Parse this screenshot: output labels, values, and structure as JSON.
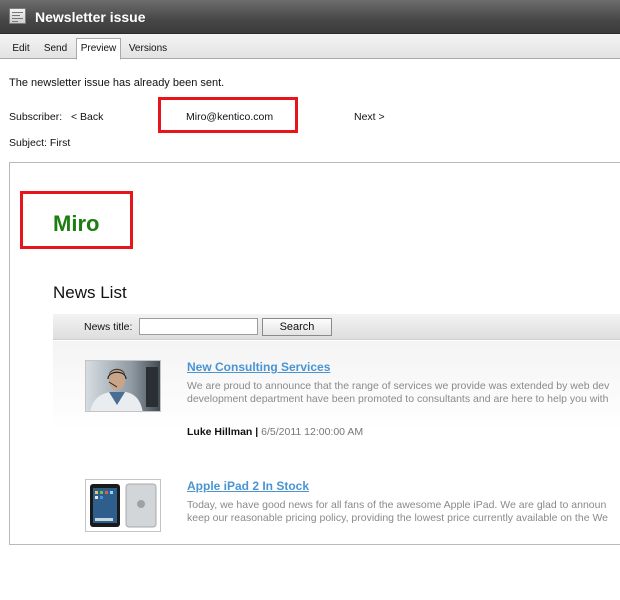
{
  "window": {
    "title": "Newsletter issue",
    "icon": "newsletter-icon"
  },
  "tabs": [
    {
      "label": "Edit",
      "active": false
    },
    {
      "label": "Send",
      "active": false
    },
    {
      "label": "Preview",
      "active": true
    },
    {
      "label": "Versions",
      "active": false
    }
  ],
  "status_message": "The newsletter issue has already been sent.",
  "subscriber": {
    "label": "Subscriber:",
    "back": "< Back",
    "email": "Miro@kentico.com",
    "next": "Next >"
  },
  "subject": {
    "text": "Subject: First"
  },
  "preview": {
    "greeting": "Miro",
    "news_list_title": "News List",
    "search": {
      "label": "News title:",
      "value": "",
      "button": "Search"
    },
    "articles": [
      {
        "title": "New Consulting Services",
        "text_line1": "We are proud to announce that the range of services we provide was extended by web dev",
        "text_line2": "development department have been promoted to consultants and are here to help you with",
        "author": "Luke Hillman",
        "separator": " | ",
        "date": "6/5/2011 12:00:00 AM",
        "thumb_icon": "consultant-photo-icon"
      },
      {
        "title": "Apple iPad 2 In Stock",
        "text_line1": "Today, we have good news for all fans of the awesome Apple iPad. We are glad to announ",
        "text_line2": "keep our reasonable pricing policy, providing the lowest price currently available on the We",
        "thumb_icon": "ipad-photo-icon"
      }
    ]
  },
  "colors": {
    "highlight_border": "#e8141c",
    "greeting": "#1e7d12",
    "link": "#4a94d2",
    "titlebar": "#474747"
  }
}
